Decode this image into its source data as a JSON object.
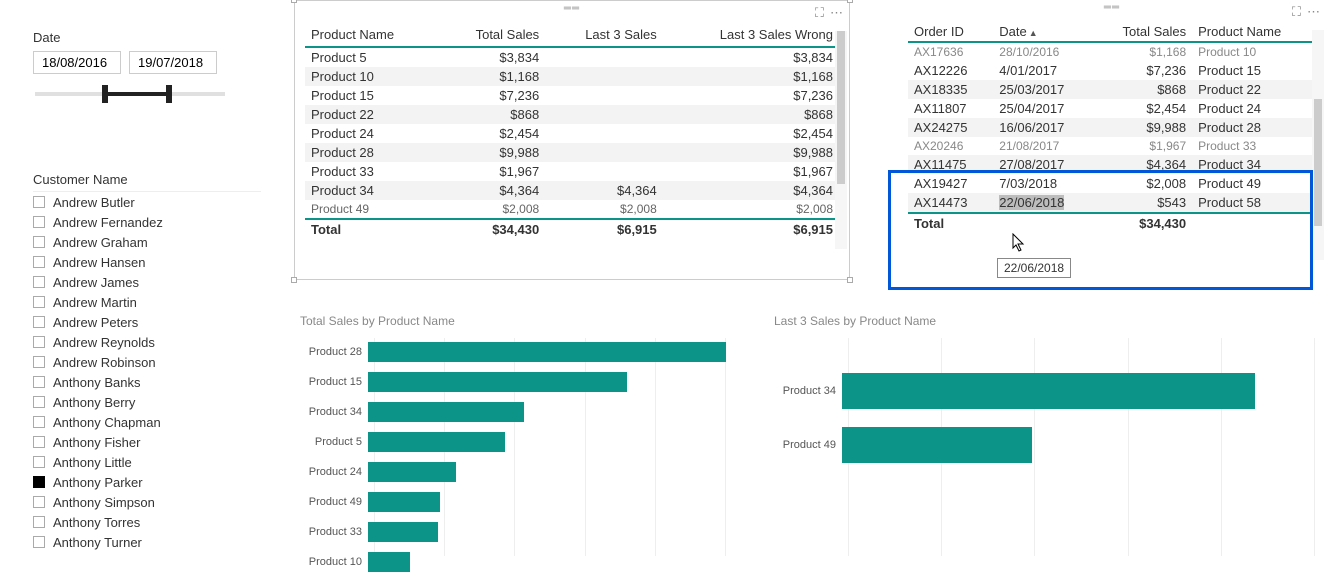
{
  "date_filter": {
    "label": "Date",
    "start": "18/08/2016",
    "end": "19/07/2018"
  },
  "customer_filter": {
    "label": "Customer Name",
    "items": [
      {
        "name": "Andrew Butler",
        "checked": false
      },
      {
        "name": "Andrew Fernandez",
        "checked": false
      },
      {
        "name": "Andrew Graham",
        "checked": false
      },
      {
        "name": "Andrew Hansen",
        "checked": false
      },
      {
        "name": "Andrew James",
        "checked": false
      },
      {
        "name": "Andrew Martin",
        "checked": false
      },
      {
        "name": "Andrew Peters",
        "checked": false
      },
      {
        "name": "Andrew Reynolds",
        "checked": false
      },
      {
        "name": "Andrew Robinson",
        "checked": false
      },
      {
        "name": "Anthony Banks",
        "checked": false
      },
      {
        "name": "Anthony Berry",
        "checked": false
      },
      {
        "name": "Anthony Chapman",
        "checked": false
      },
      {
        "name": "Anthony Fisher",
        "checked": false
      },
      {
        "name": "Anthony Little",
        "checked": false
      },
      {
        "name": "Anthony Parker",
        "checked": true
      },
      {
        "name": "Anthony Simpson",
        "checked": false
      },
      {
        "name": "Anthony Torres",
        "checked": false
      },
      {
        "name": "Anthony Turner",
        "checked": false
      }
    ]
  },
  "table1": {
    "headers": [
      "Product Name",
      "Total Sales",
      "Last 3 Sales",
      "Last 3 Sales Wrong"
    ],
    "rows": [
      {
        "product": "Product 5",
        "total": "$3,834",
        "last3": "",
        "last3w": "$3,834"
      },
      {
        "product": "Product 10",
        "total": "$1,168",
        "last3": "",
        "last3w": "$1,168"
      },
      {
        "product": "Product 15",
        "total": "$7,236",
        "last3": "",
        "last3w": "$7,236"
      },
      {
        "product": "Product 22",
        "total": "$868",
        "last3": "",
        "last3w": "$868"
      },
      {
        "product": "Product 24",
        "total": "$2,454",
        "last3": "",
        "last3w": "$2,454"
      },
      {
        "product": "Product 28",
        "total": "$9,988",
        "last3": "",
        "last3w": "$9,988"
      },
      {
        "product": "Product 33",
        "total": "$1,967",
        "last3": "",
        "last3w": "$1,967"
      },
      {
        "product": "Product 34",
        "total": "$4,364",
        "last3": "$4,364",
        "last3w": "$4,364"
      },
      {
        "product": "Product 49",
        "total": "$2,008",
        "last3": "$2,008",
        "last3w": "$2,008"
      }
    ],
    "total_label": "Total",
    "total_values": [
      "$34,430",
      "$6,915",
      "$6,915"
    ]
  },
  "table2": {
    "headers": [
      "Order ID",
      "Date",
      "Total Sales",
      "Product Name"
    ],
    "partial_top": {
      "order": "AX17636",
      "date": "28/10/2016",
      "total": "$1,168",
      "product": "Product 10"
    },
    "rows": [
      {
        "order": "AX12226",
        "date": "4/01/2017",
        "total": "$7,236",
        "product": "Product 15"
      },
      {
        "order": "AX18335",
        "date": "25/03/2017",
        "total": "$868",
        "product": "Product 22"
      },
      {
        "order": "AX11807",
        "date": "25/04/2017",
        "total": "$2,454",
        "product": "Product 24"
      },
      {
        "order": "AX24275",
        "date": "16/06/2017",
        "total": "$9,988",
        "product": "Product 28"
      },
      {
        "order": "AX20246",
        "date": "21/08/2017",
        "total": "$1,967",
        "product": "Product 33"
      },
      {
        "order": "AX11475",
        "date": "27/08/2017",
        "total": "$4,364",
        "product": "Product 34"
      },
      {
        "order": "AX19427",
        "date": "7/03/2018",
        "total": "$2,008",
        "product": "Product 49"
      },
      {
        "order": "AX14473",
        "date": "22/06/2018",
        "total": "$543",
        "product": "Product 58"
      }
    ],
    "total_label": "Total",
    "total_value": "$34,430",
    "tooltip": "22/06/2018"
  },
  "chart1": {
    "title": "Total Sales by Product Name"
  },
  "chart2": {
    "title": "Last 3 Sales by Product Name"
  },
  "chart_data": [
    {
      "type": "bar",
      "orientation": "horizontal",
      "title": "Total Sales by Product Name",
      "xlabel": "Total Sales",
      "ylabel": "Product Name",
      "categories": [
        "Product 28",
        "Product 15",
        "Product 34",
        "Product 5",
        "Product 24",
        "Product 49",
        "Product 33",
        "Product 10"
      ],
      "values": [
        9988,
        7236,
        4364,
        3834,
        2454,
        2008,
        1967,
        1168
      ],
      "xlim": [
        0,
        10000
      ]
    },
    {
      "type": "bar",
      "orientation": "horizontal",
      "title": "Last 3 Sales by Product Name",
      "xlabel": "Last 3 Sales",
      "ylabel": "Product Name",
      "categories": [
        "Product 34",
        "Product 49"
      ],
      "values": [
        4364,
        2008
      ],
      "xlim": [
        0,
        5000
      ]
    }
  ]
}
